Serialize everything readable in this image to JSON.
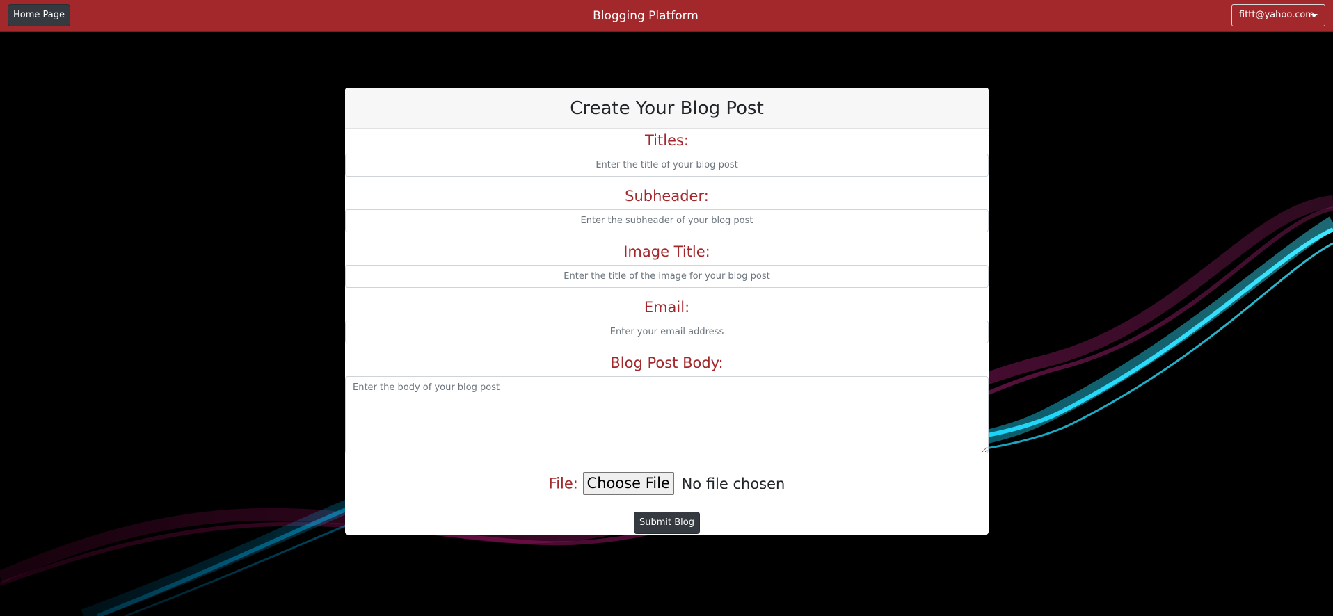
{
  "navbar": {
    "home_label": "Home Page",
    "brand": "Blogging Platform",
    "user_email": "fittt@yahoo.com",
    "color": "#a3282c"
  },
  "form": {
    "heading": "Create Your Blog Post",
    "fields": [
      {
        "label": "Titles:",
        "placeholder": "Enter the title of your blog post"
      },
      {
        "label": "Subheader:",
        "placeholder": "Enter the subheader of your blog post"
      },
      {
        "label": "Image Title:",
        "placeholder": "Enter the title of the image for your blog post"
      },
      {
        "label": "Email:",
        "placeholder": "Enter your email address"
      }
    ],
    "body": {
      "label": "Blog Post Body:",
      "placeholder": "Enter the body of your blog post"
    },
    "file": {
      "label": "File:",
      "button_label": "Choose File",
      "status": "No file chosen"
    },
    "submit_label": "Submit Blog",
    "label_color": "#a3282c"
  }
}
